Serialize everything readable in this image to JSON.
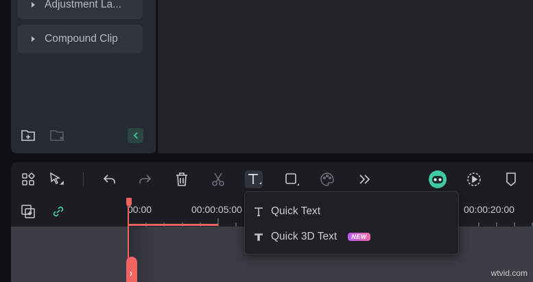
{
  "library": {
    "items": [
      {
        "label": "Adjustment La..."
      },
      {
        "label": "Compound Clip"
      }
    ]
  },
  "icons": {
    "new_folder": "folder-plus-icon",
    "remove_folder": "folder-remove-icon",
    "collapse": "chevron-left-icon"
  },
  "toolbar": {
    "tools": [
      "grid-icon",
      "select-arrow-icon",
      "undo-icon",
      "redo-icon",
      "delete-icon",
      "split-scissors-icon",
      "text-tool-icon",
      "crop-shape-icon",
      "color-palette-icon",
      "more-tools-icon",
      "ai-assistant-icon",
      "render-preview-icon",
      "marker-icon"
    ]
  },
  "ruler": {
    "labels": [
      "00:00",
      "00:00:05:00",
      "00:00:20:00"
    ]
  },
  "text_menu": {
    "items": [
      {
        "label": "Quick Text"
      },
      {
        "label": "Quick 3D Text",
        "badge": "NEW"
      }
    ]
  },
  "colors": {
    "accent": "#3ec9a7",
    "playhead": "#ef6363",
    "badge_gradient": [
      "#b85cf0",
      "#f06aa8"
    ]
  },
  "watermark": "wtvid.com"
}
